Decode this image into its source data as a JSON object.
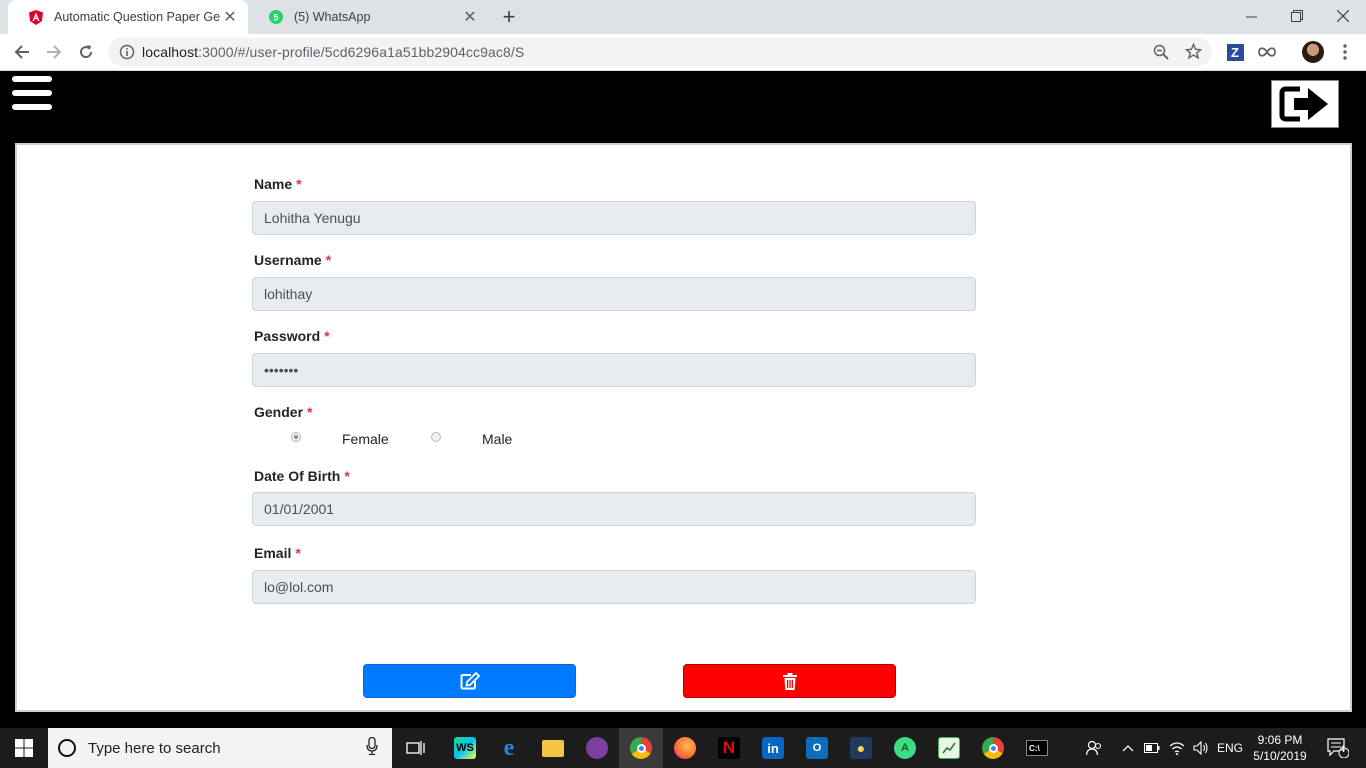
{
  "browser": {
    "tabs": [
      {
        "title": "Automatic Question Paper Gener",
        "active": true
      },
      {
        "title": "(5) WhatsApp",
        "active": false
      }
    ],
    "url_host": "localhost",
    "url_rest": ":3000/#/user-profile/5cd6296a1a51bb2904cc9ac8/S",
    "extensions": [
      "zoom-icon",
      "star-icon",
      "z-extension-icon",
      "infinity-extension-icon",
      "profile-avatar",
      "menu-icon"
    ]
  },
  "form": {
    "name_label": "Name",
    "name_value": "Lohitha Yenugu",
    "username_label": "Username",
    "username_value": "lohithay",
    "password_label": "Password",
    "password_value": "•••••••",
    "gender_label": "Gender",
    "gender_options": [
      "Female",
      "Male"
    ],
    "gender_selected": "Female",
    "dob_label": "Date Of Birth",
    "dob_value": "01/01/2001",
    "email_label": "Email",
    "email_value": "lo@lol.com",
    "required_mark": "*"
  },
  "buttons": {
    "edit_icon": "edit-icon",
    "delete_icon": "trash-icon",
    "edit_color": "#007bff",
    "delete_color": "#ff0000"
  },
  "taskbar": {
    "search_placeholder": "Type here to search",
    "language": "ENG",
    "time": "9:06 PM",
    "date": "5/10/2019",
    "notification_count": "4"
  }
}
